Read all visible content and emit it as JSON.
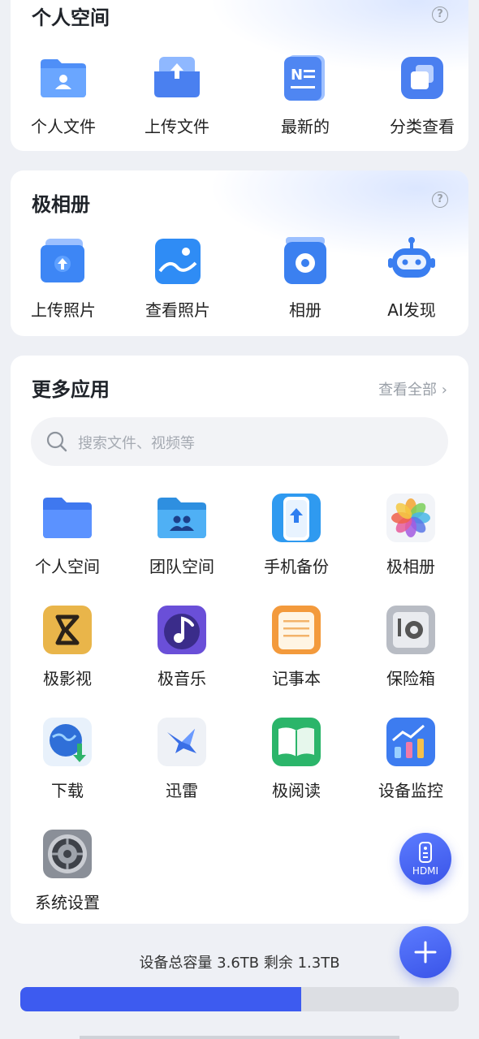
{
  "personal_space": {
    "title": "个人空间",
    "items": [
      {
        "label": "个人文件",
        "icon": "person-folder-icon"
      },
      {
        "label": "上传文件",
        "icon": "upload-folder-icon"
      },
      {
        "label": "最新的",
        "icon": "notes-icon"
      },
      {
        "label": "分类查看",
        "icon": "categories-icon"
      }
    ]
  },
  "album": {
    "title": "极相册",
    "items": [
      {
        "label": "上传照片",
        "icon": "upload-photo-icon"
      },
      {
        "label": "查看照片",
        "icon": "view-photo-icon"
      },
      {
        "label": "相册",
        "icon": "album-icon"
      },
      {
        "label": "AI发现",
        "icon": "ai-robot-icon"
      }
    ]
  },
  "more_apps": {
    "title": "更多应用",
    "see_all": "查看全部",
    "search_placeholder": "搜索文件、视频等",
    "apps": [
      {
        "label": "个人空间",
        "icon": "blue-folder-icon"
      },
      {
        "label": "团队空间",
        "icon": "team-folder-icon"
      },
      {
        "label": "手机备份",
        "icon": "phone-backup-icon"
      },
      {
        "label": "极相册",
        "icon": "photos-flower-icon"
      },
      {
        "label": "极影视",
        "icon": "video-icon"
      },
      {
        "label": "极音乐",
        "icon": "music-icon"
      },
      {
        "label": "记事本",
        "icon": "notepad-icon"
      },
      {
        "label": "保险箱",
        "icon": "safe-icon"
      },
      {
        "label": "下载",
        "icon": "download-globe-icon"
      },
      {
        "label": "迅雷",
        "icon": "thunder-bird-icon"
      },
      {
        "label": "极阅读",
        "icon": "book-icon"
      },
      {
        "label": "设备监控",
        "icon": "monitor-chart-icon"
      },
      {
        "label": "系统设置",
        "icon": "settings-gear-icon"
      }
    ]
  },
  "hdmi_button": {
    "label": "HDMI",
    "icon": "remote-control-icon"
  },
  "add_button": {
    "icon": "plus-icon"
  },
  "storage": {
    "caption": "设备总容量 3.6TB 剩余 1.3TB",
    "used_fraction": 0.64
  },
  "colors": {
    "accent": "#3d5bf0",
    "background": "#eef0f5"
  }
}
